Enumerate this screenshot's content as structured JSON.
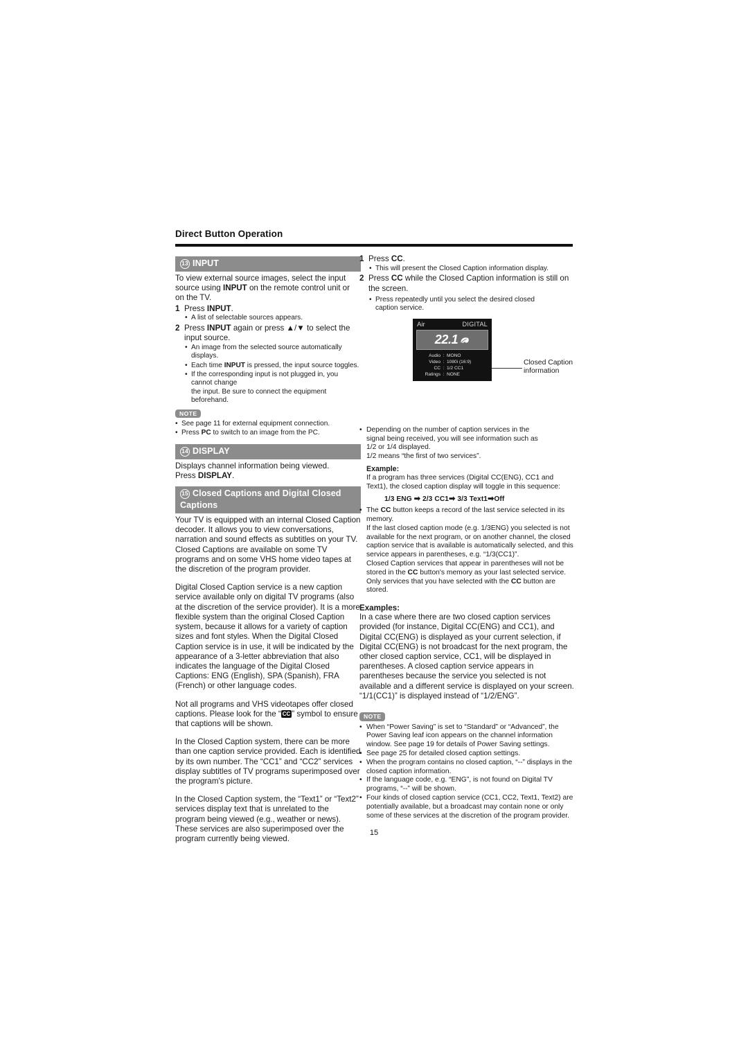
{
  "page": {
    "running_head": "Direct Button Operation",
    "page_number": "15"
  },
  "left_column": {
    "input_section": {
      "number": "13",
      "title": "INPUT",
      "intro": "To view external source images, select the input source using INPUT on the remote control unit or on the TV.",
      "intro_parts": {
        "a": "To view external source images, select the input source using ",
        "bold": "INPUT",
        "b": " on the remote control unit or on the TV."
      },
      "steps": [
        {
          "number": "1",
          "text_a": "Press ",
          "text_bold": "INPUT",
          "text_b": ".",
          "bullets": [
            "A list of selectable sources appears."
          ]
        },
        {
          "number": "2",
          "text_a": "Press ",
          "text_bold": "INPUT",
          "text_b": " again or press ▲/▼ to select the input source.",
          "bullets": [
            "An image from the selected source automatically displays.",
            "Each time INPUT is pressed, the input source toggles.",
            "If the corresponding input is not plugged in, you cannot change the input. Be sure to connect the equipment beforehand."
          ]
        }
      ],
      "bullet2_parts": {
        "b2_a": "Each time ",
        "b2_bold": "INPUT",
        "b2_b": " is pressed, the input source toggles."
      },
      "bullet3_line1": "If the corresponding input is not plugged in, you cannot change",
      "bullet3_line2": "the input. Be sure to connect the equipment beforehand.",
      "note_label": "NOTE",
      "notes": [
        "See page 11 for external equipment connection.",
        "Press PC to switch to an image from the PC."
      ],
      "note2_parts": {
        "a": "Press ",
        "bold": "PC",
        "b": " to switch to an image from the PC."
      }
    },
    "display_section": {
      "number": "14",
      "title": "DISPLAY",
      "line1": "Displays channel information being viewed.",
      "line2_a": "Press ",
      "line2_bold": "DISPLAY",
      "line2_b": "."
    },
    "cc_section": {
      "number": "15",
      "title": "Closed Captions and Digital Closed Captions",
      "para1": "Your TV is equipped with an internal Closed Caption decoder. It allows you to view conversations, narration and sound effects as subtitles on your TV. Closed Captions are available on some TV programs and on some VHS home video tapes at the discretion of the program provider.",
      "para2": "Digital Closed Caption service is a new caption service available only on digital TV programs (also at the discretion of the service provider). It is a more flexible system than the original Closed Caption system, because it allows for a variety of caption sizes and font styles. When the Digital Closed Caption service is in use, it will be indicated by the appearance of a 3-letter abbreviation that also indicates the language of the Digital Closed Captions: ENG (English), SPA (Spanish), FRA (French) or other language codes.",
      "para3_a": "Not all programs and VHS videotapes offer closed captions. Please look for the “",
      "para3_glyph": "CC",
      "para3_b": "” symbol to ensure that captions will be shown.",
      "para4": "In the Closed Caption system, there can be more than one caption service provided. Each is identified by its own number. The “CC1” and “CC2” services display subtitles of TV programs superimposed over the program's picture.",
      "para5": "In the Closed Caption system, the “Text1” or “Text2” services display text that is unrelated to the program being viewed (e.g., weather or news). These services are also superimposed over the program currently being viewed."
    }
  },
  "right_column": {
    "steps": [
      {
        "number": "1",
        "text_a": "Press ",
        "text_bold": "CC",
        "text_b": ".",
        "bullets": [
          "This will present the Closed Caption information display."
        ]
      },
      {
        "number": "2",
        "text_a": "Press ",
        "text_bold": "CC",
        "text_b": " while the Closed Caption information is still on the screen.",
        "bullets": [
          "Press repeatedly until you select the desired closed caption service."
        ]
      }
    ],
    "bullet_2_line1": "Press repeatedly until you select the desired closed",
    "bullet_2_line2": "caption service.",
    "tv_display": {
      "source_label": "Air",
      "signal_label": "DIGITAL",
      "channel": "22.1",
      "leaf_icon": "power-saving-leaf",
      "rows": [
        {
          "key": "Audio",
          "sep": ":",
          "value": "MONO"
        },
        {
          "key": "Video",
          "sep": ":",
          "value": "1080i (16:9)"
        },
        {
          "key": "CC",
          "sep": ":",
          "value": "1/2 CC1"
        },
        {
          "key": "Ratings",
          "sep": ":",
          "value": "NONE"
        }
      ],
      "callout_line1": "Closed Caption",
      "callout_line2": "information"
    },
    "bullet_depending": {
      "line1": "Depending on the number of caption services in the",
      "line2": "signal being received, you will see information such as",
      "line3": "1/2 or 1/4 displayed.",
      "line4": "1/2 means “the first of two services”."
    },
    "example_label": "Example:",
    "example_text": "If a program has three services (Digital CC(ENG), CC1 and Text1), the closed caption display will toggle in this sequence:",
    "sequence": {
      "item1": "1/3 ENG",
      "item2": "2/3 CC1",
      "item3": "3/3 Text1",
      "item4": "Off",
      "arrow": "➡"
    },
    "bullet_cc_memory": {
      "a": "The ",
      "bold1": "CC",
      "b": " button keeps a record of the last service selected in its memory.",
      "line3": "If the last closed caption mode (e.g. 1/3ENG) you selected is not available for the next program, or on another channel, the closed caption service that is available is automatically selected, and this service appears in parentheses, e.g. “1/3(CC1)”.",
      "line4_a": "Closed Caption services that appear in parentheses will not be stored in the ",
      "bold2": "CC",
      "line4_b": " button's memory as your last selected service. Only services that you have selected with the ",
      "bold3": "CC",
      "line4_c": " button are stored."
    },
    "examples_label": "Examples:",
    "examples_text": "In a case where there are two closed caption services provided (for instance, Digital CC(ENG) and CC1), and Digital CC(ENG) is displayed as your current selection, if Digital CC(ENG) is not broadcast for the next program, the other closed caption service, CC1, will be displayed in parentheses. A closed caption service appears in parentheses because the service you selected is not available and a different service is displayed on your screen. “1/1(CC1)” is displayed instead of “1/2/ENG”.",
    "note_label": "NOTE",
    "notes": [
      "When “Power Saving” is set to “Standard” or “Advanced”, the Power Saving leaf icon appears on the channel information window. See page 19 for details of Power Saving settings.",
      "See page 25 for detailed closed caption settings.",
      "When the program contains no closed caption, “--” displays in the closed caption information.",
      "If the language code, e.g. “ENG”, is not found on Digital TV programs, “--” will be shown.",
      "Four kinds of closed caption service (CC1, CC2, Text1, Text2) are potentially available, but a broadcast may contain none or only some of these services at the discretion of the program provider."
    ]
  },
  "colors": {
    "bar_gray": "#8c8c8c",
    "rule_black": "#111111",
    "tv_bg": "#121212",
    "tv_channel_box": "#6e6e6e"
  }
}
